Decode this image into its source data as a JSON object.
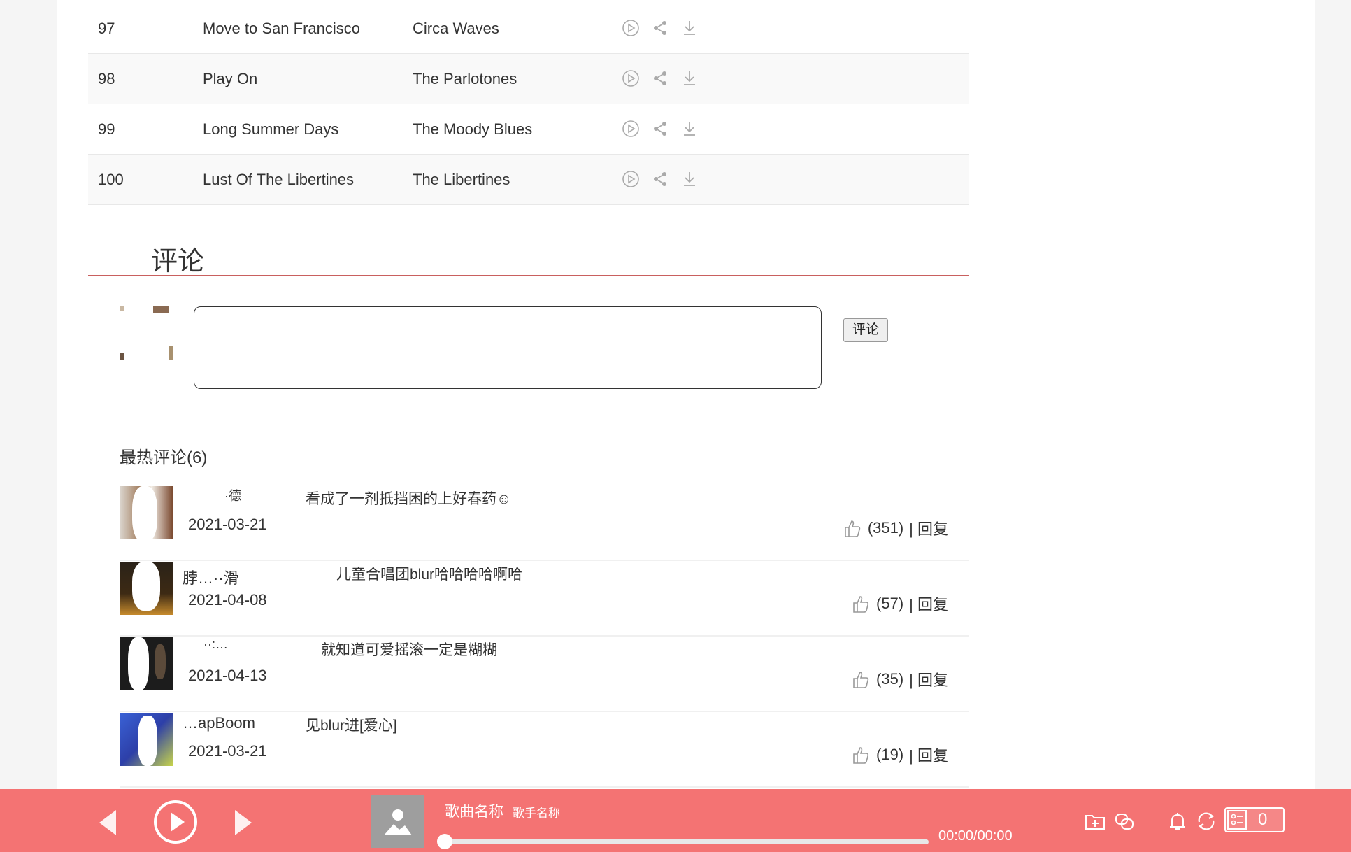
{
  "songs": [
    {
      "no": "97",
      "title": "Move to San Francisco",
      "artist": "Circa Waves"
    },
    {
      "no": "98",
      "title": "Play On",
      "artist": "The Parlotones"
    },
    {
      "no": "99",
      "title": "Long Summer Days",
      "artist": "The Moody Blues"
    },
    {
      "no": "100",
      "title": "Lust Of The Libertines",
      "artist": "The Libertines"
    }
  ],
  "comments_section": {
    "title": "评论",
    "submit_label": "评论",
    "hot_title": "最热评论(6)"
  },
  "comments": [
    {
      "nick": "  ·德",
      "text": "看成了一剂抵挡困的上好春药☺",
      "date": "2021-03-21",
      "likes": "(351)",
      "reply": "| 回复"
    },
    {
      "nick": "脖…··滑",
      "text": "儿童合唱团blur哈哈哈哈啊哈",
      "date": "2021-04-08",
      "likes": "(57)",
      "reply": "| 回复"
    },
    {
      "nick": "··:…",
      "text": "就知道可爱摇滚一定是糊糊",
      "date": "2021-04-13",
      "likes": "(35)",
      "reply": "| 回复"
    },
    {
      "nick": "…apBoom",
      "text": "见blur进[爱心]",
      "date": "2021-03-21",
      "likes": "(19)",
      "reply": "| 回复"
    }
  ],
  "player": {
    "song_name": "歌曲名称",
    "artist_name": "歌手名称",
    "time": "00:00/00:00",
    "playlist_count": "0"
  }
}
